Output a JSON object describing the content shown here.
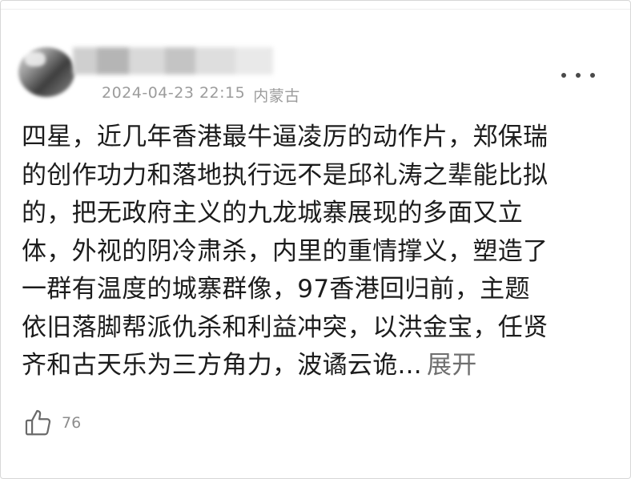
{
  "comment": {
    "author": {
      "avatar_icon": "avatar-blurred",
      "name_blurred": true
    },
    "timestamp": "2024-04-23 22:15",
    "location": "内蒙古",
    "more_icon": "more-horizontal-icon",
    "body_lines": [
      "四星，近几年香港最牛逼凌厉的动作片，郑保瑞",
      "的创作功力和落地执行远不是邱礼涛之辈能比拟",
      "的，把无政府主义的九龙城寨展现的多面又立",
      "体，外视的阴冷肃杀，内里的重情撑义，塑造了",
      "一群有温度的城寨群像，97香港回归前，主题",
      "依旧落脚帮派仇杀和利益冲突，以洪金宝，任贤",
      "齐和古天乐为三方角力，波谲云诡..."
    ],
    "expand_label": "展开",
    "like_icon": "thumbs-up-icon",
    "like_count": "76"
  },
  "colors": {
    "text": "#1c1c1c",
    "meta": "#9c9c9c",
    "link": "#6f6f6f"
  }
}
